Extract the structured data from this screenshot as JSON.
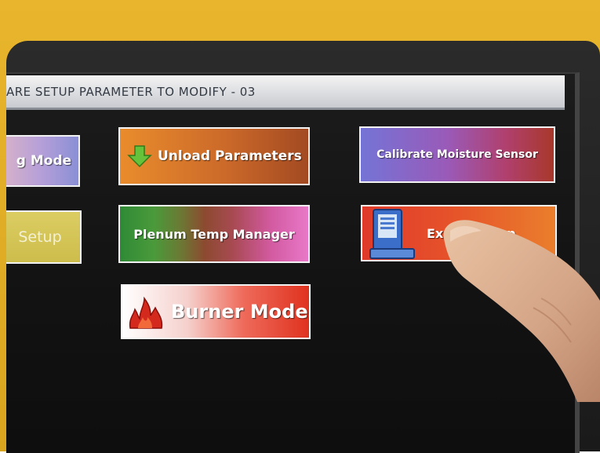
{
  "screen": {
    "title": "ARE SETUP PARAMETER TO MODIFY - 03"
  },
  "buttons": {
    "drying_mode": {
      "label": "g Mode",
      "colors": [
        "#d9b3c8",
        "#8a8fd6"
      ]
    },
    "setup": {
      "label": "Setup",
      "color": "#d6c65a"
    },
    "unload_parameters": {
      "label": "Unload Parameters",
      "icon": "green-down-arrow-icon",
      "colors": [
        "#e88a2c",
        "#a84a20"
      ]
    },
    "plenum_temp_manager": {
      "label": "Plenum Temp Manager",
      "colors": [
        "#3a8f3a",
        "#e05ab0"
      ]
    },
    "burner_mode": {
      "label": "Burner Mode",
      "icon": "flame-icon",
      "colors": [
        "#ffffff",
        "#e03020"
      ]
    },
    "calibrate_moisture_sensor": {
      "label": "Calibrate Moisture Sensor",
      "colors": [
        "#7a7ad8",
        "#b03a2a"
      ]
    },
    "extended_setup": {
      "label": "Ex    d Setup",
      "icon": "computer-icon",
      "colors": [
        "#e03a2a",
        "#e8762a"
      ]
    }
  }
}
